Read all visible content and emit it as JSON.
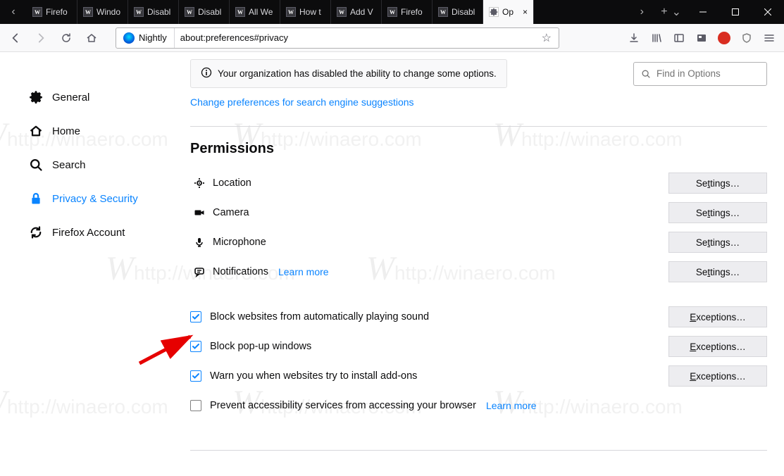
{
  "tabs": {
    "list": [
      {
        "label": "Firefo"
      },
      {
        "label": "Windo"
      },
      {
        "label": "Disabl"
      },
      {
        "label": "Disabl"
      },
      {
        "label": "All We"
      },
      {
        "label": "How t"
      },
      {
        "label": "Add V"
      },
      {
        "label": "Firefo"
      },
      {
        "label": "Disabl"
      }
    ],
    "active": {
      "label": "Op"
    }
  },
  "urlbar": {
    "identity": "Nightly",
    "url": "about:preferences#privacy"
  },
  "notice": "Your organization has disabled the ability to change some options.",
  "search": {
    "placeholder": "Find in Options"
  },
  "engine_link": "Change preferences for search engine suggestions",
  "sidebar": {
    "general": "General",
    "home": "Home",
    "search": "Search",
    "privacy": "Privacy & Security",
    "account": "Firefox Account"
  },
  "permissions": {
    "title": "Permissions",
    "location": "Location",
    "camera": "Camera",
    "microphone": "Microphone",
    "notifications": "Notifications",
    "learn_more": "Learn more",
    "settings_btn": "Settings…",
    "settings_btn_t": "tt",
    "exceptions_btn": "Exceptions…",
    "block_sound": "Block websites from automatically playing sound",
    "block_popup": "Block pop-up windows",
    "warn_addons": "Warn you when websites try to install add-ons",
    "prevent_a11y": "Prevent accessibility services from accessing your browser"
  },
  "watermark": "http://winaero.com"
}
